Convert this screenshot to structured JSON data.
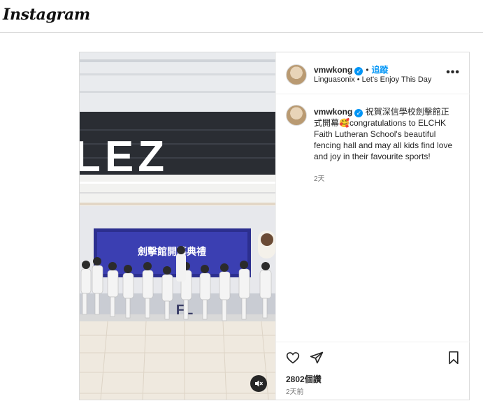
{
  "app": {
    "logo_text": "Instagram"
  },
  "post": {
    "author": {
      "username": "vmwkong",
      "verified": true,
      "follow_label": "追蹤",
      "audio_line": "Linguasonix • Let's Enjoy This Day"
    },
    "caption": {
      "username": "vmwkong",
      "text": "祝賀深信學校劍擊館正式開幕🥰congratulations to ELCHK Faith Lutheran School's beautiful fencing hall and may all kids find love and joy in their favourite sports!",
      "time": "2天"
    },
    "media": {
      "banner_text": "LEZ",
      "screen_title": "劍擊館開幕典禮",
      "floor_text": "FL"
    },
    "likes": "2802個讚",
    "timestamp": "2天前",
    "icons": [
      "heart-icon",
      "share-icon",
      "bookmark-icon",
      "more-icon",
      "mute-icon",
      "verified-icon"
    ],
    "colors": {
      "accent": "#0095f6",
      "border": "#dbdbdb",
      "muted": "#737373"
    }
  }
}
